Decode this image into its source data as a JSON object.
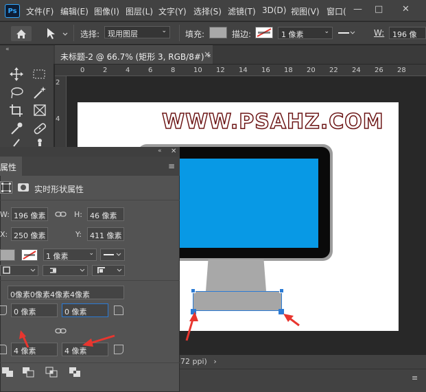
{
  "app": {
    "logo_text": "Ps"
  },
  "menu": [
    "文件(F)",
    "编辑(E)",
    "图像(I)",
    "图层(L)",
    "文字(Y)",
    "选择(S)",
    "滤镜(T)",
    "3D(D)",
    "视图(V)",
    "窗口("
  ],
  "window_controls": {
    "minimize": "—",
    "maximize": "□",
    "close": "✕"
  },
  "options": {
    "select_label": "选择:",
    "select_value": "现用图层",
    "fill_label": "填充:",
    "stroke_label": "描边:",
    "stroke_width": "1 像素",
    "w_label": "W:",
    "w_value": "196 像"
  },
  "document_tab": {
    "title": "未标题-2 @ 66.7% (矩形 3, RGB/8#) *",
    "close": "×"
  },
  "ruler": {
    "h_ticks": [
      "0",
      "2",
      "4",
      "6",
      "8",
      "10",
      "12",
      "14",
      "16",
      "18",
      "20",
      "22",
      "24",
      "26",
      "28"
    ],
    "v_ticks": [
      "2",
      "4"
    ]
  },
  "canvas": {
    "watermark": "WWW.PSAHZ.COM"
  },
  "properties": {
    "tab_label": "属性",
    "header": "实时形状属性",
    "w_label": "W:",
    "w_value": "196 像素",
    "h_label": "H:",
    "h_value": "46 像素",
    "x_label": "X:",
    "x_value": "250 像素",
    "y_label": "Y:",
    "y_value": "411 像素",
    "stroke_width": "1 像素",
    "radii_combined": "0像素0像素4像素4像素",
    "radius_tl": "0 像素",
    "radius_tr": "0 像素",
    "radius_bl": "4 像素",
    "radius_br": "4 像素"
  },
  "status": {
    "text": "72 ppi)"
  },
  "colors": {
    "accent": "#31a8ff",
    "monitor_screen": "#0899e5",
    "arrow": "#e8362f"
  }
}
